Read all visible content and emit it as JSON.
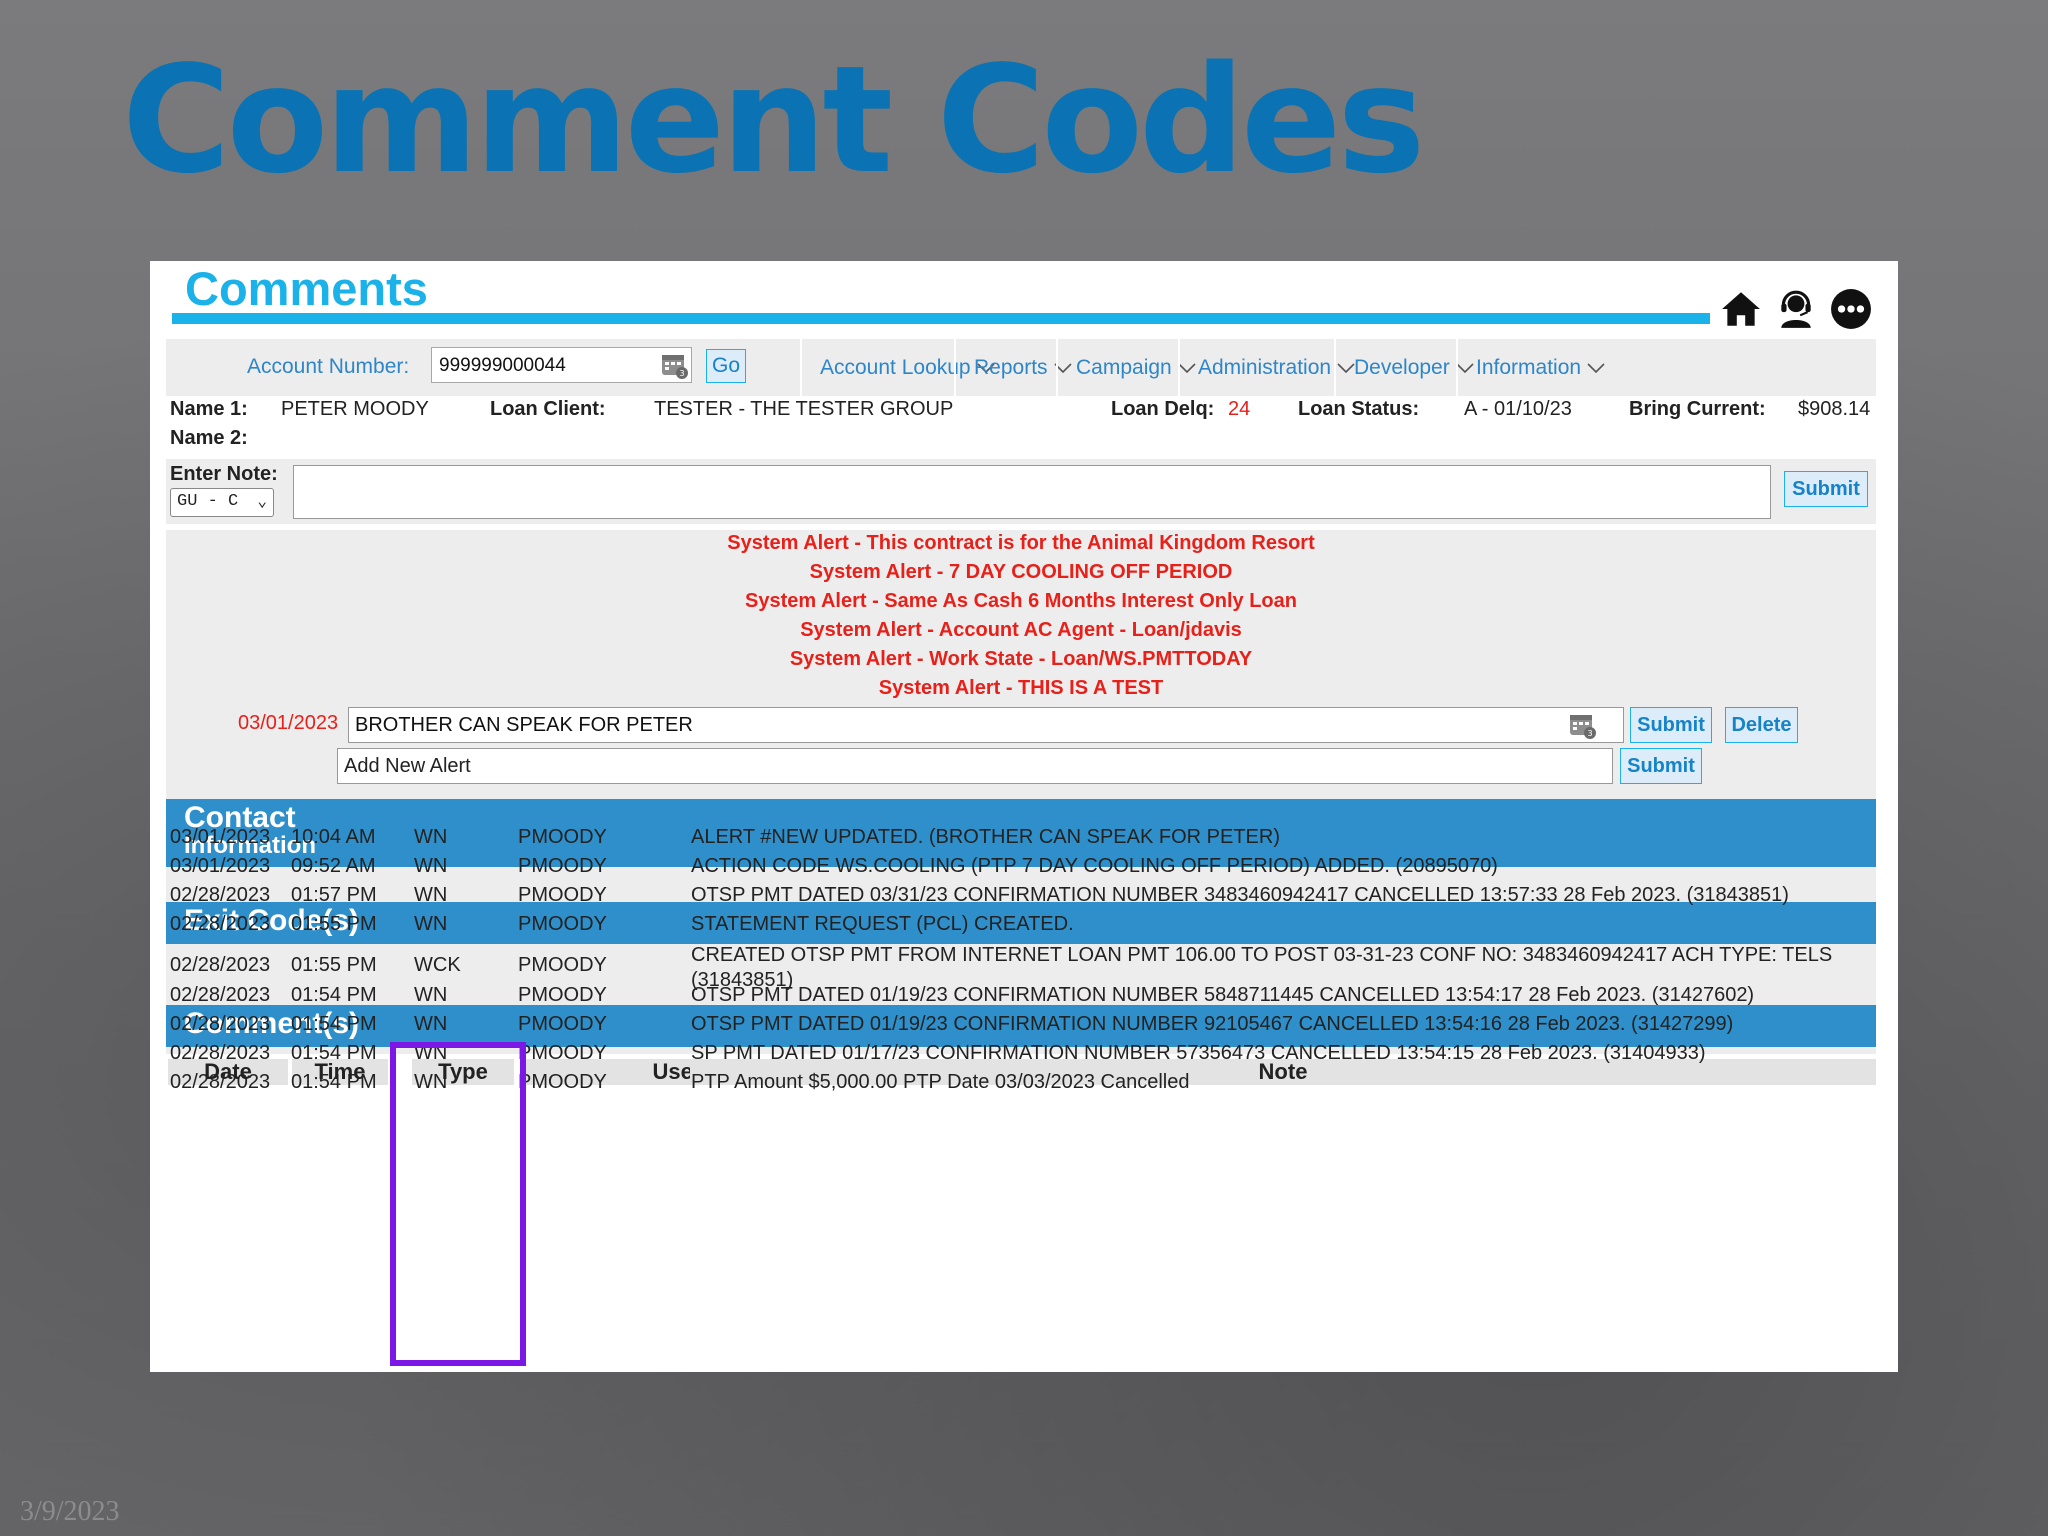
{
  "slide": {
    "title": "Comment Codes",
    "date": "3/9/2023"
  },
  "panel": {
    "title": "Comments",
    "icons": [
      "home-icon",
      "agent-headset-icon",
      "more-options-icon"
    ]
  },
  "navbar": {
    "account_label": "Account Number:",
    "account_value": "999999000044",
    "go_label": "Go",
    "menu": [
      {
        "label": "Account Lookup"
      },
      {
        "label": "Reports"
      },
      {
        "label": "Campaign"
      },
      {
        "label": "Administration"
      },
      {
        "label": "Developer"
      },
      {
        "label": "Information"
      }
    ]
  },
  "account_info": {
    "name1_label": "Name 1:",
    "name1_value": "PETER MOODY",
    "name2_label": "Name 2:",
    "loan_client_label": "Loan Client:",
    "loan_client_value": "TESTER - THE TESTER GROUP",
    "loan_delq_label": "Loan Delq:",
    "loan_delq_value": "24",
    "loan_status_label": "Loan Status:",
    "loan_status_value": "A - 01/10/23",
    "bring_current_label": "Bring Current:",
    "bring_current_value": "$908.14"
  },
  "note_entry": {
    "label": "Enter Note:",
    "select_value": "GU - C",
    "submit_label": "Submit"
  },
  "alerts": {
    "lines": [
      "System Alert - This contract is for the Animal Kingdom Resort",
      "System Alert - 7 DAY COOLING OFF PERIOD",
      "System Alert - Same As Cash 6 Months Interest Only Loan",
      "System Alert - Account AC Agent - Loan/jdavis",
      "System Alert - Work State - Loan/WS.PMTTODAY",
      "System Alert - THIS IS A TEST"
    ],
    "edit_date": "03/01/2023",
    "edit_value": "BROTHER CAN SPEAK FOR PETER",
    "edit_submit": "Submit",
    "edit_delete": "Delete",
    "new_placeholder": "Add New Alert",
    "new_submit": "Submit"
  },
  "sections": {
    "contact_line1": "Contact",
    "contact_line2": "Information",
    "exit_codes": "Exit Code(s)",
    "comments": "Comment(s)"
  },
  "comments_table": {
    "headers": [
      "Date",
      "Time",
      "Type",
      "User",
      "Note"
    ],
    "rows": [
      {
        "date": "03/01/2023",
        "time": "10:04 AM",
        "type": "WN",
        "user": "PMOODY",
        "note": "ALERT #NEW UPDATED. (BROTHER CAN SPEAK FOR PETER)"
      },
      {
        "date": "03/01/2023",
        "time": "09:52 AM",
        "type": "WN",
        "user": "PMOODY",
        "note": "ACTION CODE WS.COOLING (PTP 7 DAY COOLING OFF PERIOD) ADDED. (20895070)"
      },
      {
        "date": "02/28/2023",
        "time": "01:57 PM",
        "type": "WN",
        "user": "PMOODY",
        "note": "OTSP PMT DATED 03/31/23 CONFIRMATION NUMBER 3483460942417 CANCELLED 13:57:33 28 Feb 2023. (31843851)"
      },
      {
        "date": "02/28/2023",
        "time": "01:55 PM",
        "type": "WN",
        "user": "PMOODY",
        "note": "STATEMENT REQUEST (PCL) CREATED."
      },
      {
        "date": "02/28/2023",
        "time": "01:55 PM",
        "type": "WCK",
        "user": "PMOODY",
        "note": "CREATED OTSP PMT FROM INTERNET LOAN PMT 106.00 TO POST 03-31-23 CONF NO: 3483460942417 ACH TYPE: TELS",
        "note2": "(31843851)"
      },
      {
        "date": "02/28/2023",
        "time": "01:54 PM",
        "type": "WN",
        "user": "PMOODY",
        "note": "OTSP PMT DATED 01/19/23 CONFIRMATION NUMBER 5848711445 CANCELLED 13:54:17 28 Feb 2023. (31427602)"
      },
      {
        "date": "02/28/2023",
        "time": "01:54 PM",
        "type": "WN",
        "user": "PMOODY",
        "note": "OTSP PMT DATED 01/19/23 CONFIRMATION NUMBER 92105467 CANCELLED 13:54:16 28 Feb 2023. (31427299)"
      },
      {
        "date": "02/28/2023",
        "time": "01:54 PM",
        "type": "WN",
        "user": "PMOODY",
        "note": "SP PMT DATED 01/17/23 CONFIRMATION NUMBER 57356473 CANCELLED 13:54:15 28 Feb 2023. (31404933)"
      },
      {
        "date": "02/28/2023",
        "time": "01:54 PM",
        "type": "WN",
        "user": "PMOODY",
        "note": "PTP Amount $5,000.00 PTP Date 03/03/2023 Cancelled"
      }
    ]
  },
  "colors": {
    "title_blue": "#0b73b3",
    "accent_cyan": "#1ab2e8",
    "section_blue": "#2e8fca",
    "alert_red": "#e8201a",
    "highlight_purple": "#7b18e6"
  }
}
